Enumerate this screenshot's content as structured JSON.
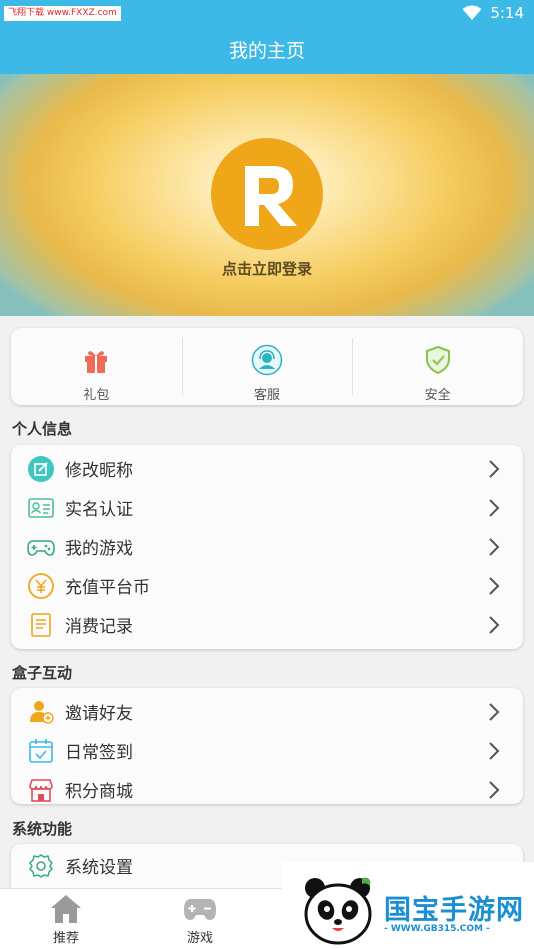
{
  "statusbar": {
    "time": "5:14",
    "watermark": "飞翔下载 www.FXXZ.com"
  },
  "header": {
    "title": "我的主页"
  },
  "profile": {
    "avatar_letter": "R",
    "login_text": "点击立即登录"
  },
  "quick_actions": [
    {
      "label": "礼包",
      "icon": "gift-icon",
      "color": "#f06a5a"
    },
    {
      "label": "客服",
      "icon": "customer-service-icon",
      "color": "#2bb3c6"
    },
    {
      "label": "安全",
      "icon": "shield-check-icon",
      "color": "#8bc34a"
    }
  ],
  "sections": {
    "personal": {
      "title": "个人信息",
      "items": [
        {
          "label": "修改昵称",
          "icon": "edit-icon"
        },
        {
          "label": "实名认证",
          "icon": "id-card-icon"
        },
        {
          "label": "我的游戏",
          "icon": "gamepad-icon"
        },
        {
          "label": "充值平台币",
          "icon": "yuan-coin-icon"
        },
        {
          "label": "消费记录",
          "icon": "receipt-icon"
        }
      ]
    },
    "interaction": {
      "title": "盒子互动",
      "items": [
        {
          "label": "邀请好友",
          "icon": "invite-user-icon"
        },
        {
          "label": "日常签到",
          "icon": "calendar-check-icon"
        },
        {
          "label": "积分商城",
          "icon": "store-icon"
        }
      ]
    },
    "system": {
      "title": "系统功能",
      "items": [
        {
          "label": "系统设置",
          "icon": "settings-gear-icon"
        }
      ]
    }
  },
  "bottom_nav": [
    {
      "label": "推荐",
      "icon": "home-icon"
    },
    {
      "label": "游戏",
      "icon": "game-controller-icon"
    }
  ],
  "brand_watermark": {
    "text": "国宝手游网",
    "url": "- WWW.GB315.COM -"
  },
  "colors": {
    "accent": "#3cb9e6",
    "avatar": "#f0a619"
  }
}
